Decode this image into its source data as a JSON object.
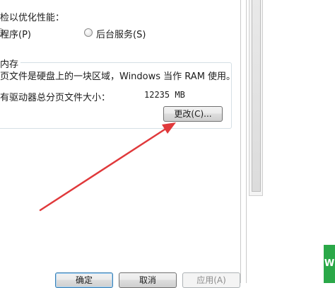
{
  "performance": {
    "heading": "检以优化性能：",
    "radio_programs": "程序(P)",
    "radio_background": "后台服务(S)"
  },
  "virtual_memory": {
    "legend": "内存",
    "description": "页文件是硬盘上的一块区域，Windows 当作 RAM 使用。",
    "total_label": "有驱动器总分页文件大小：",
    "total_value": "12235 MB",
    "change_button": "更改(C)..."
  },
  "footer": {
    "ok": "确定",
    "cancel": "取消",
    "apply": "应用(A)"
  },
  "colors": {
    "annotation_arrow": "#e0393b",
    "watermark": "#2aa848"
  },
  "watermark_text": "W"
}
